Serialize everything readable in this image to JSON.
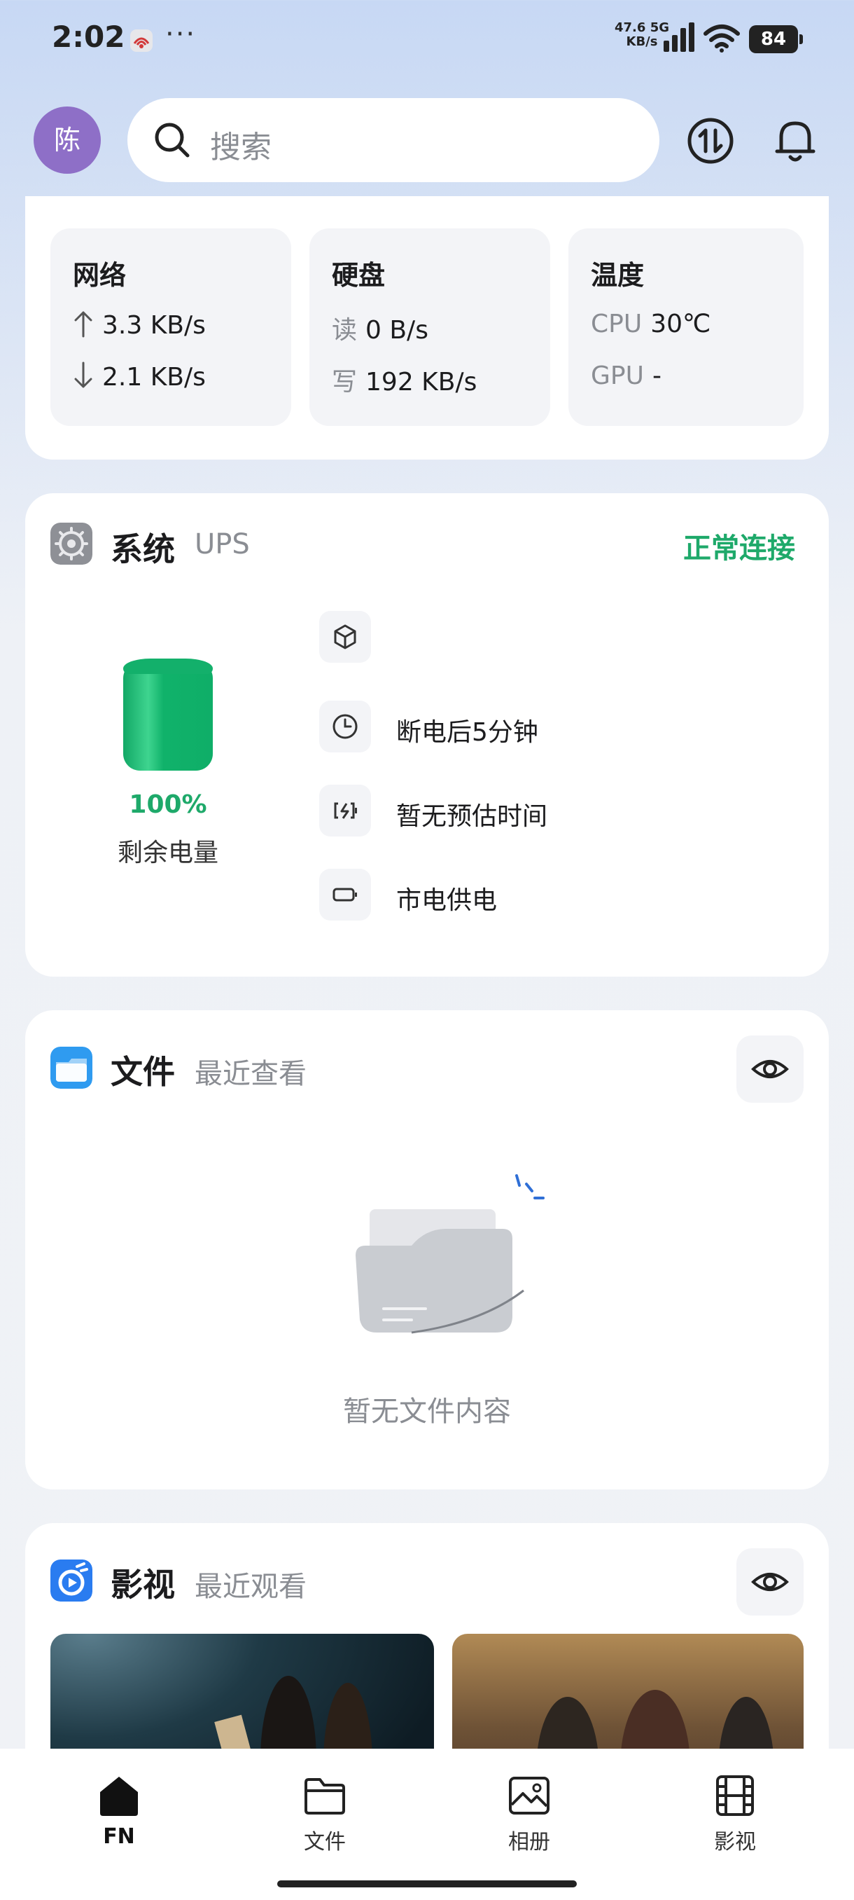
{
  "status_bar": {
    "time": "2:02",
    "more": "···",
    "net_speed_value": "47.6",
    "net_speed_unit": "KB/s",
    "network_type": "5G",
    "battery": "84"
  },
  "header": {
    "avatar_text": "陈",
    "search_placeholder": "搜索"
  },
  "metrics": {
    "network": {
      "title": "网络",
      "up": "3.3 KB/s",
      "down": "2.1 KB/s"
    },
    "disk": {
      "title": "硬盘",
      "read_label": "读",
      "read_value": "0 B/s",
      "write_label": "写",
      "write_value": "192 KB/s"
    },
    "temperature": {
      "title": "温度",
      "cpu_label": "CPU",
      "cpu_value": "30℃",
      "gpu_label": "GPU",
      "gpu_value": "-"
    }
  },
  "ups": {
    "title": "系统",
    "subtitle": "UPS",
    "status": "正常连接",
    "status_color": "#1ea96a",
    "battery_percent_text": "100%",
    "battery_percent": 100,
    "battery_label": "剩余电量",
    "rows": [
      {
        "icon": "cube-icon",
        "text": ""
      },
      {
        "icon": "clock-icon",
        "text": "断电后5分钟"
      },
      {
        "icon": "battery-charging-icon",
        "text": "暂无预估时间"
      },
      {
        "icon": "battery-outline-icon",
        "text": "市电供电"
      }
    ]
  },
  "files": {
    "title": "文件",
    "subtitle": "最近查看",
    "empty_text": "暂无文件内容"
  },
  "video": {
    "title": "影视",
    "subtitle": "最近观看"
  },
  "bottom_nav": [
    {
      "label": "FN",
      "icon": "home-icon",
      "active": true
    },
    {
      "label": "文件",
      "icon": "folder-icon",
      "active": false
    },
    {
      "label": "相册",
      "icon": "image-icon",
      "active": false
    },
    {
      "label": "影视",
      "icon": "film-icon",
      "active": false
    }
  ]
}
